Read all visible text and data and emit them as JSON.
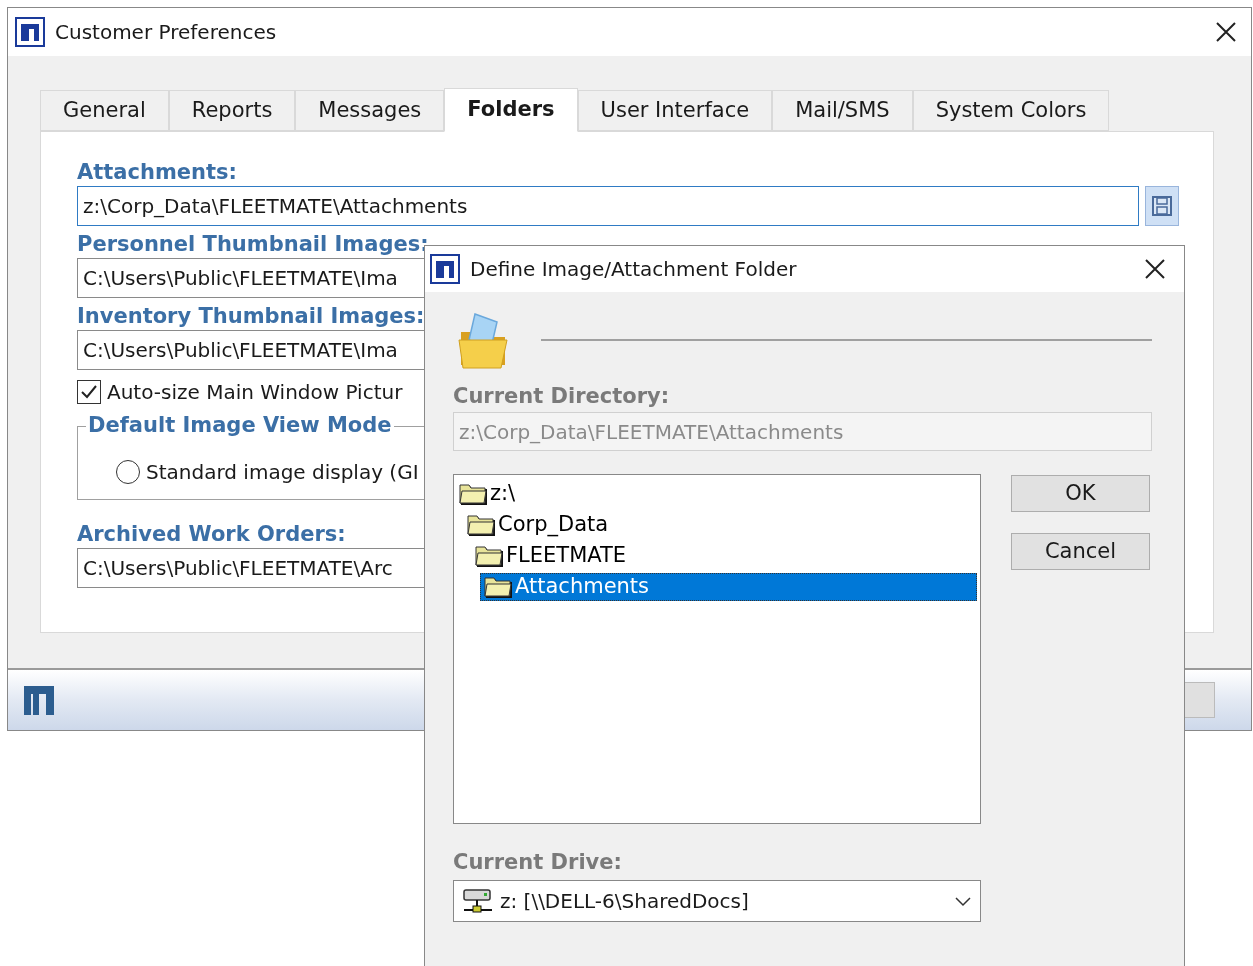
{
  "main_window": {
    "title": "Customer Preferences",
    "tabs": [
      {
        "label": "General",
        "selected": false
      },
      {
        "label": "Reports",
        "selected": false
      },
      {
        "label": "Messages",
        "selected": false
      },
      {
        "label": "Folders",
        "selected": true
      },
      {
        "label": "User Interface",
        "selected": false
      },
      {
        "label": "Mail/SMS",
        "selected": false
      },
      {
        "label": "System Colors",
        "selected": false
      }
    ],
    "items": [
      {
        "kind": "field",
        "label": "Attachments:",
        "value": "z:\\Corp_Data\\FLEETMATE\\Attachments",
        "focused": true,
        "browse": true
      },
      {
        "kind": "field",
        "label": "Personnel Thumbnail Images:",
        "value": "C:\\Users\\Public\\FLEETMATE\\Ima",
        "focused": false
      },
      {
        "kind": "field",
        "label": "Inventory Thumbnail Images:",
        "value": "C:\\Users\\Public\\FLEETMATE\\Ima",
        "focused": false
      },
      {
        "kind": "checkbox",
        "label": "Auto-size Main Window Pictur",
        "checked": true
      },
      {
        "kind": "group",
        "title": "Default Image View Mode",
        "options": [
          {
            "label": "Standard image display (GI",
            "selected": false
          }
        ]
      },
      {
        "kind": "field",
        "label": "Archived Work Orders:",
        "value": "C:\\Users\\Public\\FLEETMATE\\Arc",
        "focused": false
      }
    ]
  },
  "dialog": {
    "title": "Define Image/Attachment Folder",
    "current_directory_label": "Current Directory:",
    "current_directory": "z:\\Corp_Data\\FLEETMATE\\Attachments",
    "tree": [
      {
        "label": "z:\\",
        "selected": false,
        "children": [
          {
            "label": "Corp_Data",
            "selected": false,
            "children": [
              {
                "label": "FLEETMATE",
                "selected": false,
                "children": [
                  {
                    "label": "Attachments",
                    "selected": true
                  }
                ]
              }
            ]
          }
        ]
      }
    ],
    "buttons": [
      "OK",
      "Cancel"
    ],
    "drive_label": "Current Drive:",
    "drive": "z: [\\\\DELL-6\\SharedDocs]"
  }
}
